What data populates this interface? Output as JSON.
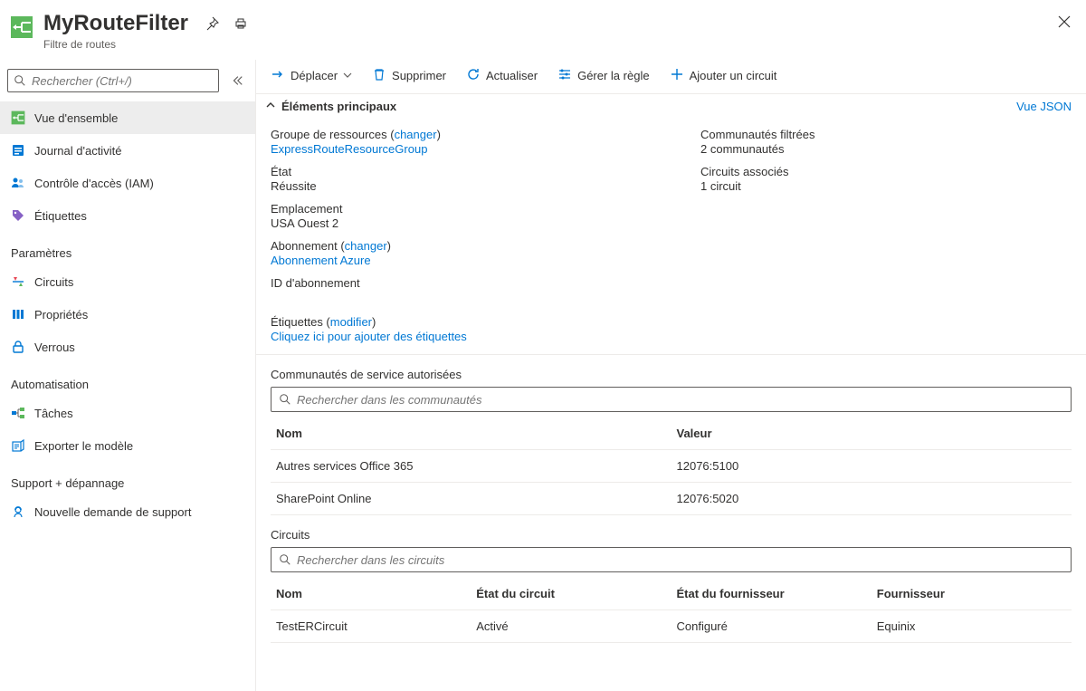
{
  "header": {
    "title": "MyRouteFilter",
    "subtitle": "Filtre de routes"
  },
  "sidebar": {
    "search_placeholder": "Rechercher (Ctrl+/)",
    "items_top": [
      {
        "label": "Vue d'ensemble",
        "icon": "overview"
      },
      {
        "label": "Journal d'activité",
        "icon": "activity"
      },
      {
        "label": "Contrôle d'accès (IAM)",
        "icon": "iam"
      },
      {
        "label": "Étiquettes",
        "icon": "tags"
      }
    ],
    "section_settings": "Paramètres",
    "items_settings": [
      {
        "label": "Circuits",
        "icon": "circuits"
      },
      {
        "label": "Propriétés",
        "icon": "properties"
      },
      {
        "label": "Verrous",
        "icon": "locks"
      }
    ],
    "section_automation": "Automatisation",
    "items_automation": [
      {
        "label": "Tâches",
        "icon": "tasks"
      },
      {
        "label": "Exporter le modèle",
        "icon": "export"
      }
    ],
    "section_support": "Support + dépannage",
    "items_support": [
      {
        "label": "Nouvelle demande de support",
        "icon": "support"
      }
    ]
  },
  "toolbar": {
    "move": "Déplacer",
    "delete": "Supprimer",
    "refresh": "Actualiser",
    "manage_rule": "Gérer la règle",
    "add_circuit": "Ajouter un circuit"
  },
  "essentials": {
    "header": "Éléments principaux",
    "view_json": "Vue JSON",
    "left": {
      "resource_group_label": "Groupe de ressources (",
      "resource_group_change": "changer",
      "resource_group_close": ")",
      "resource_group_value": "ExpressRouteResourceGroup",
      "state_label": "État",
      "state_value": "Réussite",
      "location_label": "Emplacement",
      "location_value": "USA Ouest 2",
      "subscription_label": "Abonnement (",
      "subscription_change": "changer",
      "subscription_close": ")",
      "subscription_value": "Abonnement Azure",
      "subscription_id_label": "ID d'abonnement"
    },
    "right": {
      "filtered_label": "Communautés filtrées",
      "filtered_value": "2 communautés",
      "circuits_label": "Circuits associés",
      "circuits_value": "1 circuit"
    },
    "tags_label": "Étiquettes (",
    "tags_edit": "modifier",
    "tags_close": ")",
    "tags_add": "Cliquez ici pour ajouter des étiquettes"
  },
  "communities": {
    "title": "Communautés de service autorisées",
    "search_placeholder": "Rechercher dans les communautés",
    "columns": {
      "name": "Nom",
      "value": "Valeur"
    },
    "rows": [
      {
        "name": "Autres services Office 365",
        "value": "12076:5100"
      },
      {
        "name": "SharePoint Online",
        "value": "12076:5020"
      }
    ]
  },
  "circuits": {
    "title": "Circuits",
    "search_placeholder": "Rechercher dans les circuits",
    "columns": {
      "name": "Nom",
      "state": "État du circuit",
      "provstate": "État du fournisseur",
      "provider": "Fournisseur"
    },
    "rows": [
      {
        "name": "TestERCircuit",
        "state": "Activé",
        "provstate": "Configuré",
        "provider": "Equinix"
      }
    ]
  }
}
